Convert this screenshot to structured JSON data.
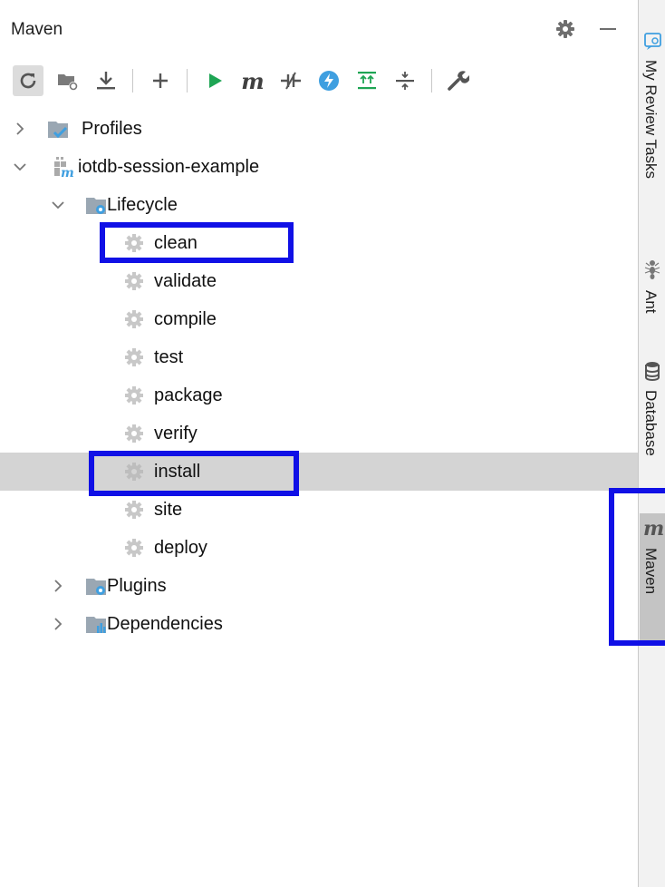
{
  "panel": {
    "title": "Maven",
    "toolbar": [
      {
        "name": "reload-icon"
      },
      {
        "name": "generate-sources-icon"
      },
      {
        "name": "download-icon"
      },
      {
        "name": "add-icon"
      },
      {
        "name": "run-icon"
      },
      {
        "name": "execute-goal-icon",
        "text": "m"
      },
      {
        "name": "toggle-offline-icon"
      },
      {
        "name": "skip-tests-icon"
      },
      {
        "name": "expand-all-icon"
      },
      {
        "name": "collapse-all-icon"
      },
      {
        "name": "settings-wrench-icon"
      }
    ]
  },
  "tree": {
    "profiles": "Profiles",
    "project": "iotdb-session-example",
    "lifecycle": "Lifecycle",
    "goals": [
      "clean",
      "validate",
      "compile",
      "test",
      "package",
      "verify",
      "install",
      "site",
      "deploy"
    ],
    "selected_goal": "install",
    "plugins": "Plugins",
    "dependencies": "Dependencies"
  },
  "stripe": {
    "review": "My Review Tasks",
    "ant": "Ant",
    "database": "Database",
    "maven": "Maven",
    "maven_icon": "m"
  },
  "colors": {
    "highlight": "#1010e6",
    "selection": "#d4d4d4",
    "run_green": "#1ea554",
    "folder_blue": "#3f9fe0"
  }
}
